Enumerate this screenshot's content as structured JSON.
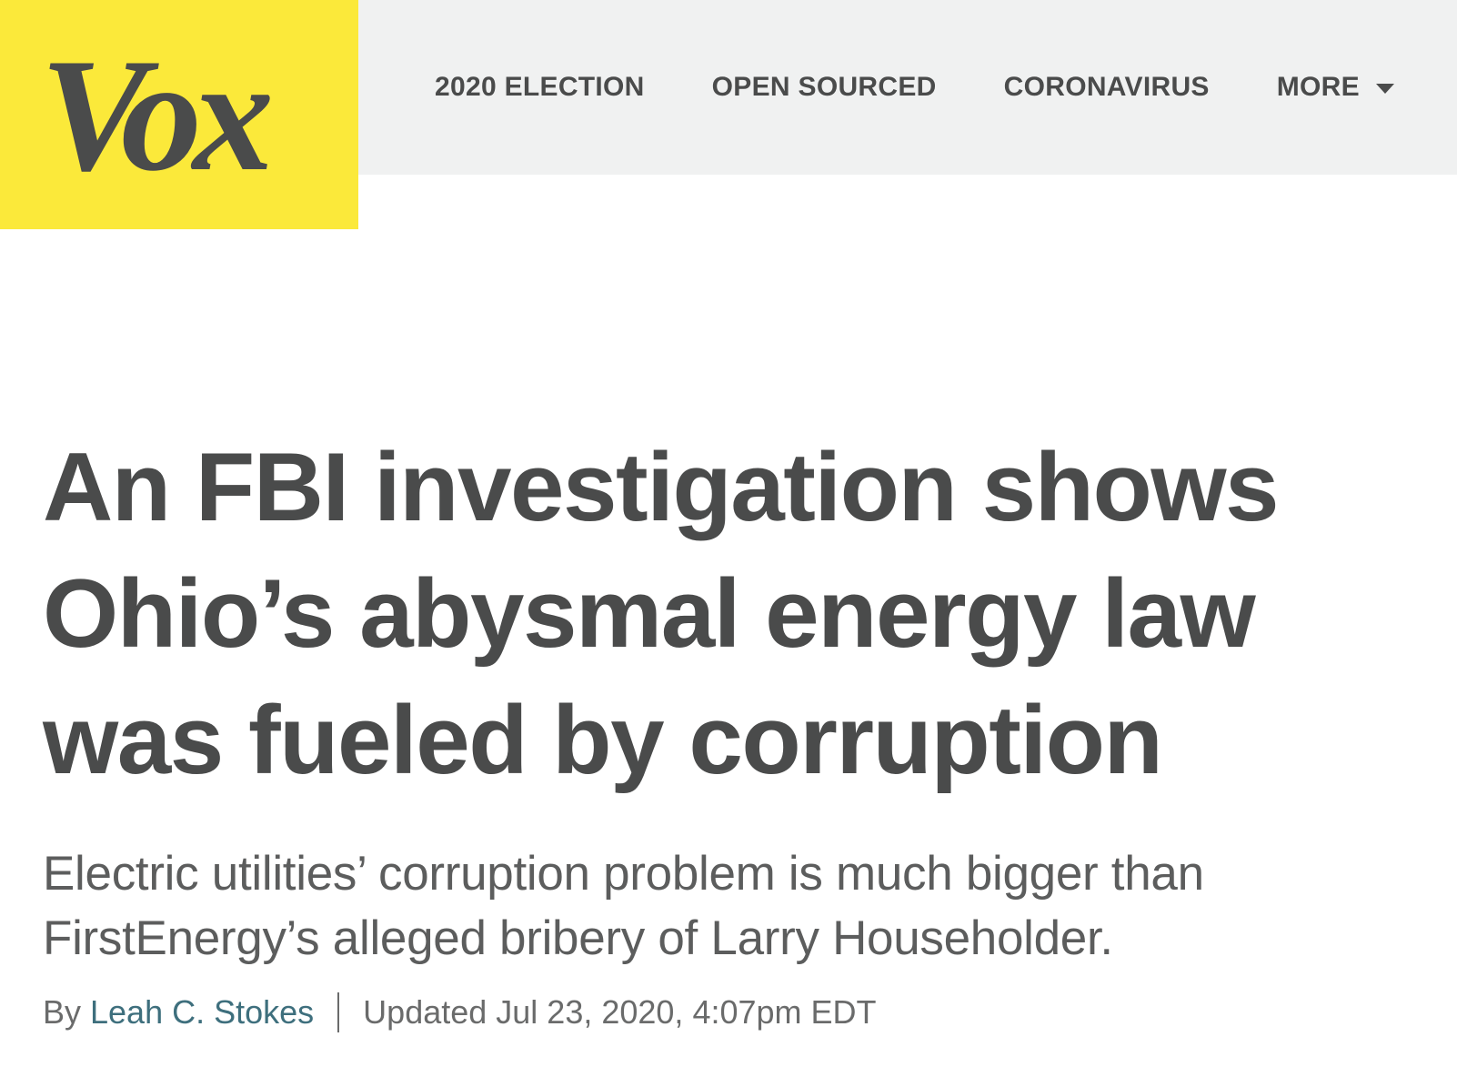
{
  "site": {
    "logo_text": "Vox",
    "brand_color": "#fbe93a",
    "header_bg": "#f0f1f1",
    "text_color": "#4a4b4b",
    "link_color": "#3e6f7d"
  },
  "nav": {
    "items": [
      {
        "label": "2020 ELECTION"
      },
      {
        "label": "OPEN SOURCED"
      },
      {
        "label": "CORONAVIRUS"
      },
      {
        "label": "MORE",
        "icon": "chevron-down-icon"
      }
    ]
  },
  "article": {
    "headline": "An FBI investigation shows Ohio’s abysmal energy law was fueled by corruption",
    "dek": "Electric utilities’ corruption problem is much bigger than FirstEnergy’s alleged bribery of Larry Householder.",
    "byline": {
      "prefix": "By",
      "author": "Leah C. Stokes",
      "updated": "Updated Jul 23, 2020, 4:07pm EDT"
    }
  }
}
